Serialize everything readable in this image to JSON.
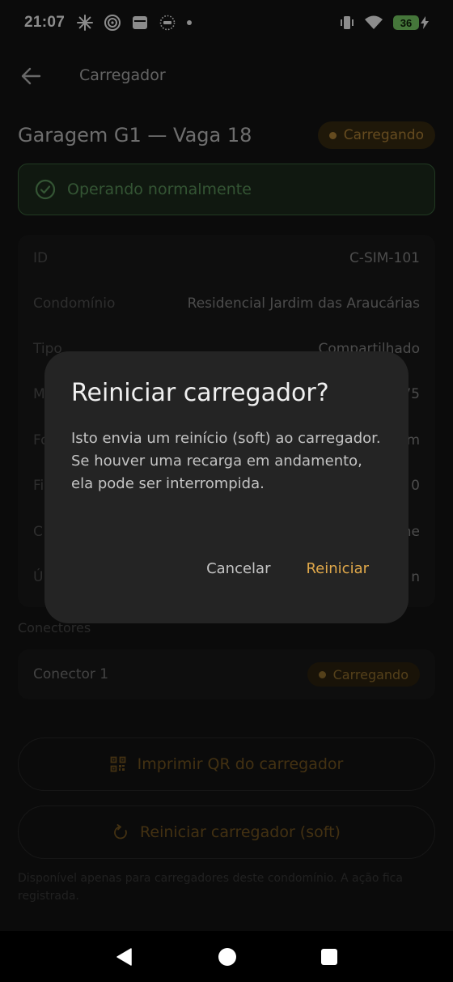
{
  "status_bar": {
    "time": "21:07",
    "battery": "36"
  },
  "topbar": {
    "title": "Carregador"
  },
  "charger": {
    "name": "Garagem G1 — Vaga 18",
    "status_badge": "Carregando",
    "health": "Operando normalmente"
  },
  "details": [
    {
      "key": "ID",
      "value": "C-SIM-101"
    },
    {
      "key": "Condomínio",
      "value": "Residencial Jardim das Araucárias"
    },
    {
      "key": "Tipo",
      "value": "Compartilhado"
    },
    {
      "key": "M",
      "value": "75"
    },
    {
      "key": "Fo",
      "value": "m"
    },
    {
      "key": "Fi",
      "value": "0"
    },
    {
      "key": "C",
      "value": "ne"
    },
    {
      "key": "Ú",
      "value": "n"
    }
  ],
  "connectors": {
    "section_label": "Conectores",
    "items": [
      {
        "name": "Conector 1",
        "status": "Carregando"
      }
    ]
  },
  "actions": {
    "print_qr": "Imprimir QR do carregador",
    "soft_reset": "Reiniciar carregador (soft)",
    "footnote": "Disponível apenas para carregadores deste condomínio. A ação fica registrada."
  },
  "dialog": {
    "title": "Reiniciar carregador?",
    "body": "Isto envia um reinício (soft) ao carregador. Se houver uma recarga em andamento, ela pode ser interrompida.",
    "cancel_label": "Cancelar",
    "confirm_label": "Reiniciar"
  },
  "colors": {
    "accent": "#e0a84a",
    "success": "#5f9c5f",
    "background": "#141414",
    "dialog_surface": "#242424"
  },
  "icons": {
    "back": "arrow-left-icon",
    "health": "check-circle-icon",
    "qr": "qr-code-icon",
    "reset": "restart-icon"
  }
}
